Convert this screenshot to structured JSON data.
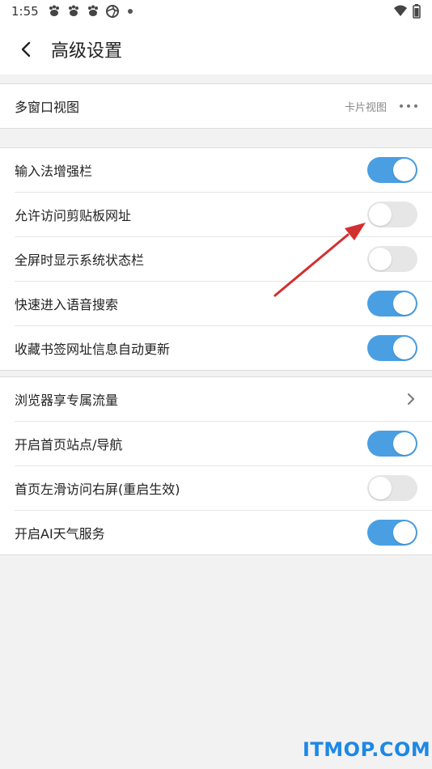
{
  "status_bar": {
    "time": "1:55"
  },
  "header": {
    "title": "高级设置"
  },
  "sections": [
    {
      "rows": [
        {
          "label": "多窗口视图",
          "value": "卡片视图"
        }
      ]
    },
    {
      "rows": [
        {
          "label": "输入法增强栏",
          "toggle": true
        },
        {
          "label": "允许访问剪贴板网址",
          "toggle": false
        },
        {
          "label": "全屏时显示系统状态栏",
          "toggle": false
        },
        {
          "label": "快速进入语音搜索",
          "toggle": true
        },
        {
          "label": "收藏书签网址信息自动更新",
          "toggle": true
        }
      ]
    },
    {
      "rows": [
        {
          "label": "浏览器享专属流量"
        },
        {
          "label": "开启首页站点/导航",
          "toggle": true
        },
        {
          "label": "首页左滑访问右屏(重启生效)",
          "toggle": false
        },
        {
          "label": "开启AI天气服务",
          "toggle": true
        }
      ]
    }
  ],
  "colors": {
    "toggle_on": "#4a9fe3",
    "toggle_off": "#e6e6e6",
    "annotation_arrow": "#d32f2f",
    "watermark": "#1E88E5"
  },
  "watermark": "ITMOP.COM"
}
